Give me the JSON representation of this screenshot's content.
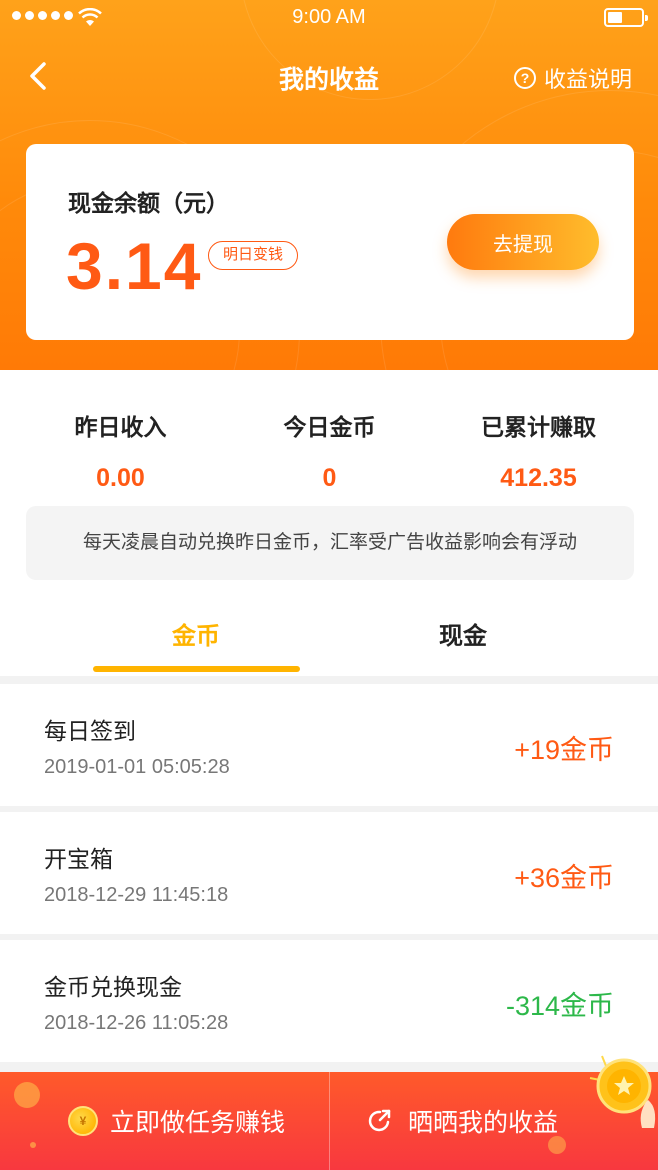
{
  "status_bar": {
    "time": "9:00 AM"
  },
  "nav": {
    "title": "我的收益",
    "help_label": "收益说明"
  },
  "balance": {
    "label": "现金余额（元）",
    "amount": "3.14",
    "tag": "明日变钱",
    "withdraw_label": "去提现"
  },
  "stats": [
    {
      "label": "昨日收入",
      "value": "0.00"
    },
    {
      "label": "今日金币",
      "value": "0"
    },
    {
      "label": "已累计赚取",
      "value": "412.35"
    }
  ],
  "notice": "每天凌晨自动兑换昨日金币，汇率受广告收益影响会有浮动",
  "tabs": [
    {
      "label": "金币",
      "active": true
    },
    {
      "label": "现金",
      "active": false
    }
  ],
  "records": [
    {
      "title": "每日签到",
      "time": "2019-01-01 05:05:28",
      "amount": "+19金币"
    },
    {
      "title": "开宝箱",
      "time": "2018-12-29 11:45:18",
      "amount": "+36金币"
    },
    {
      "title": "金币兑换现金",
      "time": "2018-12-26 11:05:28",
      "amount": "-314金币"
    }
  ],
  "bottom_bar": {
    "tasks_label": "立即做任务赚钱",
    "share_label": "晒晒我的收益",
    "coin_glyph": "¥"
  },
  "icons": {
    "back": "chevron-left-icon",
    "help": "question-circle-icon",
    "coin": "coin-icon",
    "share": "share-icon"
  },
  "colors": {
    "header_orange": "#ff8a0a",
    "accent_orange": "#ff5a14",
    "tab_active": "#ffb400",
    "negative_green": "#2db84a",
    "bottom_bar_red": "#f8383f"
  }
}
